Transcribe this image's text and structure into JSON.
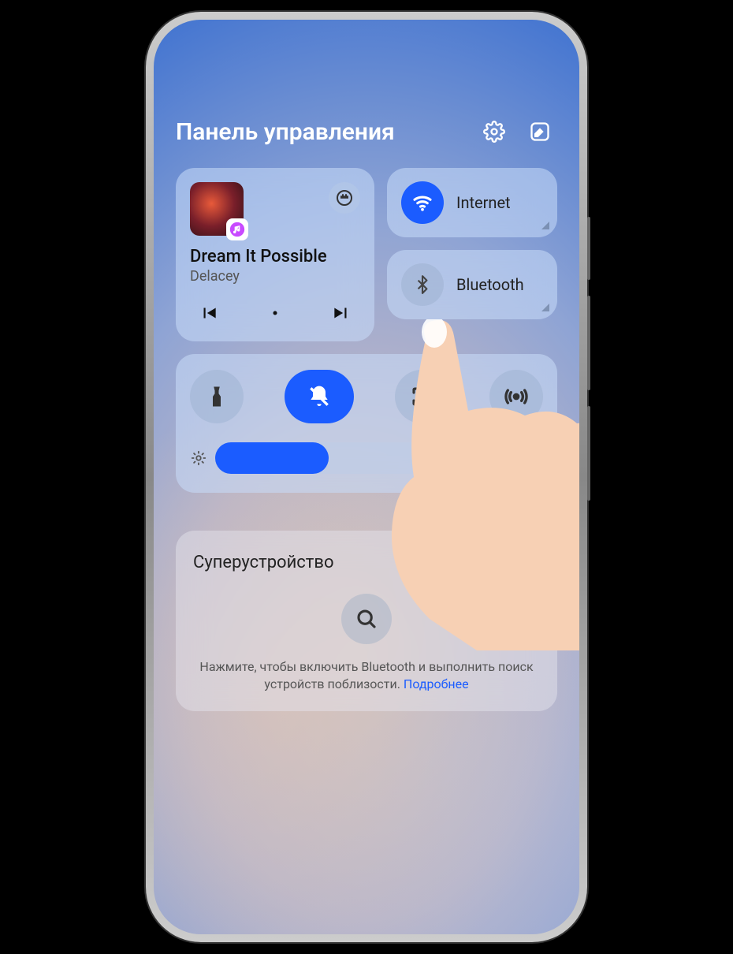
{
  "header": {
    "title": "Панель управления"
  },
  "music": {
    "song_title": "Dream It Possible",
    "artist": "Delacey"
  },
  "toggles": {
    "internet_label": "Internet",
    "bluetooth_label": "Bluetooth"
  },
  "quick": {
    "flashlight": "flashlight-icon",
    "mute": "mute-icon",
    "screenshot": "screenshot-icon",
    "nfc": "nfc-icon"
  },
  "brightness": {
    "percent": 38
  },
  "super_device": {
    "title": "Суперустройство",
    "hint_prefix": "Нажмите, чтобы включить Bluetooth и выполнить поиск устройств поблизости. ",
    "hint_link": "Подробнее"
  },
  "colors": {
    "accent": "#1b5cff"
  }
}
